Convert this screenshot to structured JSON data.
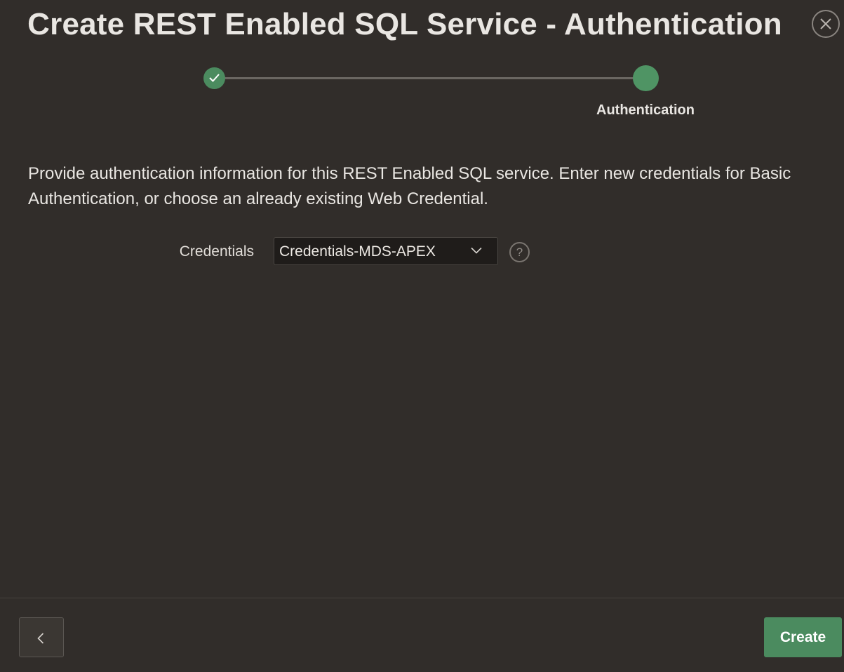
{
  "dialog": {
    "title": "Create REST Enabled SQL Service - Authentication"
  },
  "wizard": {
    "steps": [
      {
        "label": "",
        "status": "completed"
      },
      {
        "label": "Authentication",
        "status": "current"
      }
    ]
  },
  "main": {
    "description": "Provide authentication information for this REST Enabled SQL service. Enter new credentials for Basic Authentication, or choose an already existing Web Credential.",
    "credentials": {
      "label": "Credentials",
      "selected_value": "Credentials-MDS-APEX"
    }
  },
  "footer": {
    "create_label": "Create"
  },
  "icons": {
    "close": "close-icon",
    "check": "check-icon",
    "chevron": "chevron-down-icon",
    "help": "help-icon",
    "back": "chevron-left-icon"
  },
  "colors": {
    "background": "#312d2a",
    "accent": "#4b8b5f",
    "text": "#e9e6e2"
  }
}
